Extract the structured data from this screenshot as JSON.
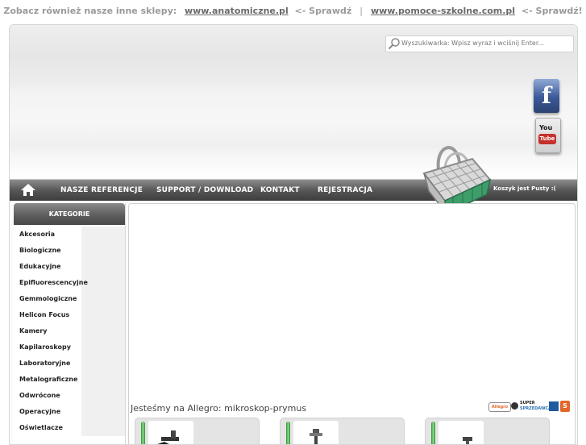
{
  "topbar": {
    "prefix": "Zobacz również nasze inne sklepy:",
    "links": [
      {
        "label": "www.anatomiczne.pl",
        "suffix": "<- Sprawdź"
      },
      {
        "label": "www.pomoce-szkolne.com.pl",
        "suffix": "<- Sprawdź!"
      }
    ],
    "separator": "|"
  },
  "search": {
    "placeholder": "Wyszukiwarka: Wpisz wyraz i wciśnij Enter..."
  },
  "social": [
    {
      "name": "facebook",
      "icon": "facebook-icon",
      "glyph": "f"
    },
    {
      "name": "youtube",
      "icon": "youtube-icon",
      "text_top": "You",
      "text_bottom": "Tube"
    }
  ],
  "nav": {
    "home_icon": "home-icon",
    "items": [
      {
        "label": "NASZE REFERENCJE"
      },
      {
        "label": "SUPPORT / DOWNLOAD"
      },
      {
        "label": "KONTAKT"
      },
      {
        "label": "REJESTRACJA"
      }
    ]
  },
  "cart": {
    "icon": "shopping-basket-icon",
    "status": "Koszyk jest Pusty :("
  },
  "categories": {
    "title": "KATEGORIE",
    "items": [
      "Akcesoria",
      "Biologiczne",
      "Edukacyjne",
      "Epifluorescencyjne",
      "Gemmologiczne",
      "Helicon Focus",
      "Kamery",
      "Kapilaroskopy",
      "Laboratoryjne",
      "Metalograficzne",
      "Odwrócone",
      "Operacyjne",
      "Oświetlacze"
    ]
  },
  "allegro": {
    "title": "Jesteśmy na Allegro: mikroskop-prymus",
    "badges": {
      "allegro": "Allegro",
      "super_top": "SUPER",
      "super_bottom": "SPRZEDAWCA",
      "s_logo": "S"
    },
    "products": [
      {
        "thumb_icon": "microscope-icon"
      },
      {
        "thumb_icon": "microscope-icon"
      },
      {
        "thumb_icon": "microscope-icon"
      }
    ]
  },
  "colors": {
    "nav_bg": "#4a4a4a",
    "accent_green": "#3aa33a",
    "facebook": "#3b5998",
    "youtube_red": "#c4302b"
  }
}
